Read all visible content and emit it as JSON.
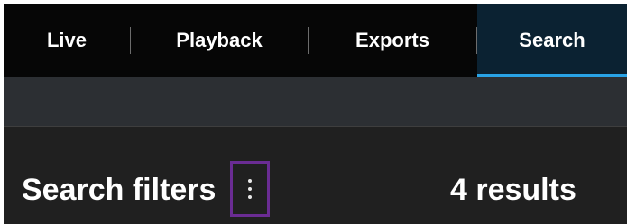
{
  "tabs": [
    {
      "label": "Live",
      "active": false
    },
    {
      "label": "Playback",
      "active": false
    },
    {
      "label": "Exports",
      "active": false
    },
    {
      "label": "Search",
      "active": true
    }
  ],
  "colors": {
    "tab_bar_bg": "#060606",
    "active_tab_bg": "#0b2232",
    "active_tab_underline": "#29a3e6",
    "panel_bg": "#202020",
    "highlight_box": "#6a2c93"
  },
  "search_panel": {
    "title": "Search filters",
    "more_icon": "vertical-ellipsis-icon",
    "results": "4 results"
  }
}
